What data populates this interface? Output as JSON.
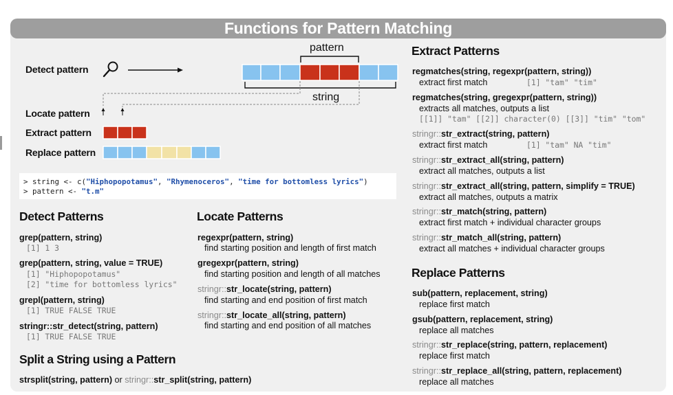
{
  "title": "Functions for Pattern Matching",
  "diagram": {
    "pattern_label": "pattern",
    "string_label": "string",
    "rows": {
      "detect": "Detect pattern",
      "locate": "Locate pattern",
      "extract": "Extract pattern",
      "replace": "Replace pattern"
    },
    "colors": {
      "blue": "#87c3ef",
      "red": "#c9321b",
      "yellow": "#f2e2a6",
      "sheet": "#f0f0f0",
      "header": "#9e9e9e"
    },
    "icons": {
      "search": "magnifier-icon",
      "arrow": "right-arrow-icon"
    }
  },
  "code": {
    "line1_prefix": "> string <- c(",
    "line1_s1": "\"Hiphopopotamus\"",
    "line1_sep1": ", ",
    "line1_s2": "\"Rhymenoceros\"",
    "line1_sep2": ", ",
    "line1_s3": "\"time for bottomless lyrics\"",
    "line1_suffix": ")",
    "line2_prefix": "> pattern <- ",
    "line2_s1": "\"t.m\""
  },
  "detect": {
    "heading": "Detect Patterns",
    "grep": {
      "sig": "grep(pattern, string)",
      "out": "[1] 1 3"
    },
    "grep_value": {
      "sig": "grep(pattern, string, value = TRUE)",
      "out1": "[1] \"Hiphopopotamus\"",
      "out2": "[2] \"time for bottomless lyrics\""
    },
    "grepl": {
      "sig": "grepl(pattern, string)",
      "out": "[1]  TRUE FALSE  TRUE"
    },
    "str_detect": {
      "pkg": "stringr::",
      "sig": "str_detect(string, pattern)",
      "out": "[1]  TRUE FALSE  TRUE"
    }
  },
  "split": {
    "heading": "Split a String using a Pattern",
    "sig1": "strsplit(string, pattern)",
    "or": " or ",
    "pkg": "stringr::",
    "sig2": "str_split(string, pattern)"
  },
  "locate": {
    "heading": "Locate Patterns",
    "regexpr": {
      "sig": "regexpr(pattern, string)",
      "desc": "find starting position and length of first match"
    },
    "gregexpr": {
      "sig": "gregexpr(pattern, string)",
      "desc": "find starting position and length of all matches"
    },
    "str_locate": {
      "pkg": "stringr::",
      "sig": "str_locate(string, pattern)",
      "desc": "find starting and end position of first match"
    },
    "str_locate_all": {
      "pkg": "stringr::",
      "sig": "str_locate_all(string, pattern)",
      "desc": "find starting and end position of all matches"
    }
  },
  "extract": {
    "heading": "Extract Patterns",
    "regmatches1": {
      "sig": "regmatches(string, regexpr(pattern, string))",
      "desc": "extract first match",
      "out": "[1] \"tam\" \"tim\""
    },
    "regmatches2": {
      "sig": "regmatches(string, gregexpr(pattern, string))",
      "desc": "extracts all matches, outputs a list",
      "out": "[[1]] \"tam\" [[2]] character(0) [[3]] \"tim\" \"tom\""
    },
    "str_extract": {
      "pkg": "stringr::",
      "sig": "str_extract(string, pattern)",
      "desc": "extract first match",
      "out": "[1] \"tam\" NA  \"tim\""
    },
    "str_extract_all": {
      "pkg": "stringr::",
      "sig": "str_extract_all(string, pattern)",
      "desc": "extract all matches, outputs a list"
    },
    "str_extract_all_simplify": {
      "pkg": "stringr::",
      "sig": "str_extract_all(string, pattern, simplify = TRUE)",
      "desc": "extract all matches, outputs a matrix"
    },
    "str_match": {
      "pkg": "stringr::",
      "sig": "str_match(string, pattern)",
      "desc": "extract first match + individual character groups"
    },
    "str_match_all": {
      "pkg": "stringr::",
      "sig": "str_match_all(string, pattern)",
      "desc": "extract all matches + individual character groups"
    }
  },
  "replace": {
    "heading": "Replace Patterns",
    "sub": {
      "sig": "sub(pattern, replacement, string)",
      "desc": "replace first match"
    },
    "gsub": {
      "sig": "gsub(pattern, replacement, string)",
      "desc": "replace all matches"
    },
    "str_replace": {
      "pkg": "stringr::",
      "sig": "str_replace(string, pattern, replacement)",
      "desc": "replace first match"
    },
    "str_replace_all": {
      "pkg": "stringr::",
      "sig": "str_replace_all(string, pattern, replacement)",
      "desc": "replace all matches"
    }
  }
}
